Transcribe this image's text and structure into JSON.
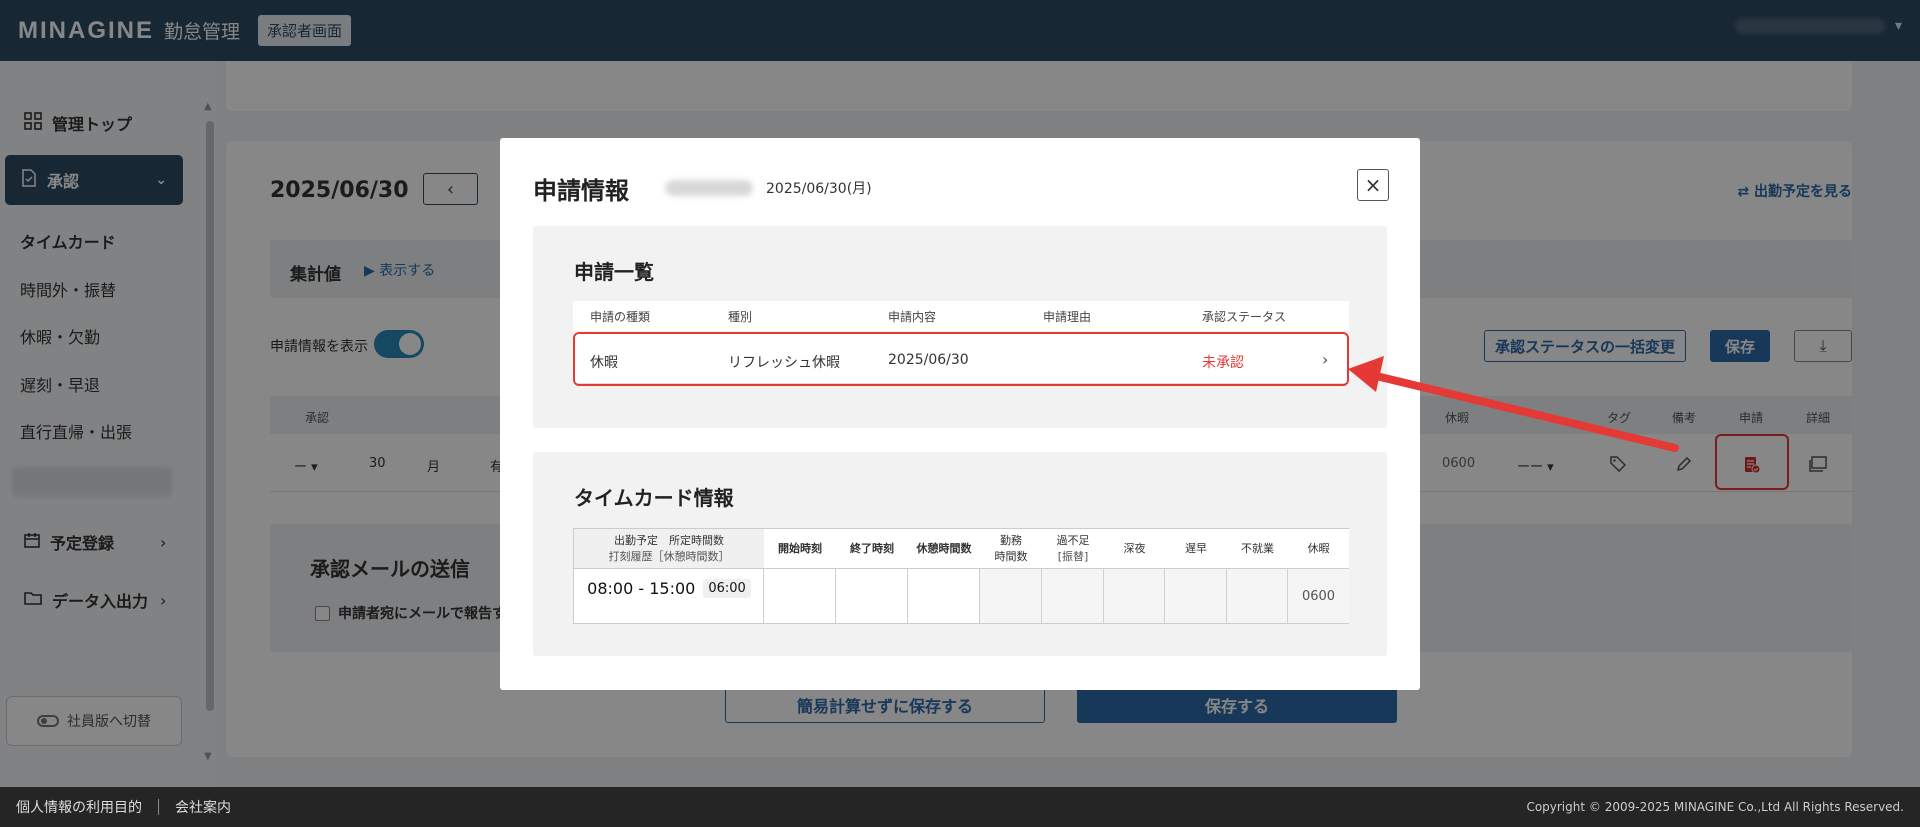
{
  "header": {
    "brand": "MINAGINE",
    "brand_sub": "勤怠管理",
    "role_badge": "承認者画面"
  },
  "sidebar": {
    "top_label": "管理トップ",
    "approve_label": "承認",
    "sub_items": [
      "タイムカード",
      "時間外・振替",
      "休暇・欠勤",
      "遅刻・早退",
      "直行直帰・出張"
    ],
    "schedule_label": "予定登録",
    "data_label": "データ入出力",
    "switch_label": "社員版へ切替"
  },
  "main": {
    "date_title": "2025/06/30",
    "schedule_link": "出勤予定を見る",
    "summary_label": "集計値",
    "summary_toggle": "表示する",
    "show_request_label": "申請情報を表示",
    "bulk_button": "承認ステータスの一括変更",
    "save_small": "保存",
    "grid_headers": {
      "approve": "承認",
      "leave": "休暇",
      "tag": "タグ",
      "note": "備考",
      "request": "申請",
      "detail": "詳細"
    },
    "grid_row": {
      "approve_value": "ー",
      "day": "30",
      "weekday": "月",
      "extra": "有",
      "leave_value": "0600",
      "shift_value": "ーー"
    },
    "mail_title": "承認メールの送信",
    "mail_check_label": "申請者宛にメールで報告す",
    "save_no_calc": "簡易計算せずに保存する",
    "save_button": "保存する"
  },
  "modal": {
    "title": "申請情報",
    "date": "2025/06/30(月)",
    "request_list_title": "申請一覧",
    "request_columns": [
      "申請の種類",
      "種別",
      "申請内容",
      "申請理由",
      "承認ステータス"
    ],
    "request_row": {
      "type": "休暇",
      "kind": "リフレッシュ休暇",
      "content": "2025/06/30",
      "reason": "",
      "status": "未承認"
    },
    "timecard_title": "タイムカード情報",
    "timecard_headers": {
      "schedule_line1": "出勤予定　所定時間数",
      "schedule_line2": "打刻履歴［休憩時間数］",
      "start": "開始時刻",
      "end": "終了時刻",
      "break": "休憩時間数",
      "work_line1": "勤務",
      "work_line2": "時間数",
      "over_line1": "過不足",
      "over_line2": "[振替]",
      "night": "深夜",
      "late": "遅早",
      "absent": "不就業",
      "leave": "休暇"
    },
    "timecard_row": {
      "schedule_time": "08:00 - 15:00",
      "schedule_hours": "06:00",
      "leave": "0600"
    }
  },
  "footer": {
    "privacy": "個人情報の利用目的",
    "company": "会社案内",
    "copyright": "Copyright © 2009-2025 MINAGINE Co.,Ltd All Rights Reserved."
  },
  "colors": {
    "header_bg": "#2d4a63",
    "accent": "#2d6aa8",
    "highlight_red": "#e53935",
    "overlay": "rgba(0,0,0,0.47)"
  }
}
